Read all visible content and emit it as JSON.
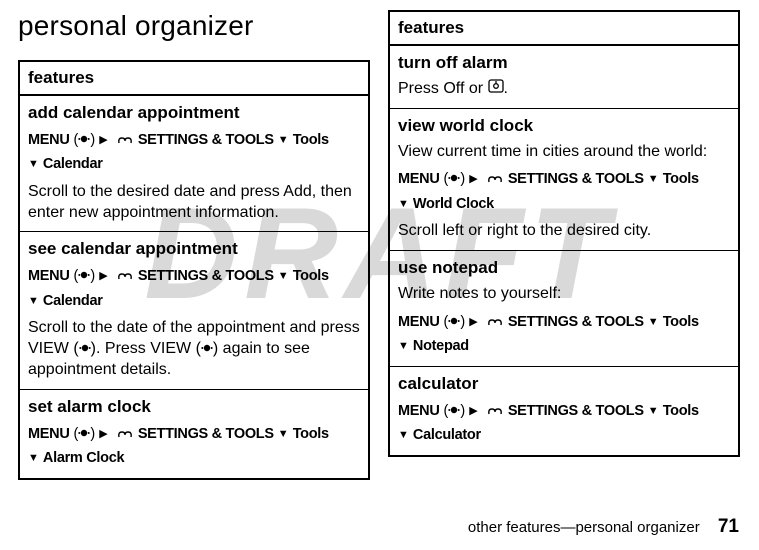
{
  "watermark": "DRAFT",
  "heading": "personal organizer",
  "col1": {
    "header": "features",
    "rows": [
      {
        "title": "add calendar appointment",
        "nav": {
          "menu": "MENU",
          "settings": "SETTINGS & TOOLS",
          "tools": "Tools",
          "sub": "Calendar"
        },
        "desc_pre": "Scroll to the desired date and press ",
        "desc_key": "Add",
        "desc_post": ", then enter new appointment information."
      },
      {
        "title": "see calendar appointment",
        "nav": {
          "menu": "MENU",
          "settings": "SETTINGS & TOOLS",
          "tools": "Tools",
          "sub": "Calendar"
        },
        "desc_pre": "Scroll to the date of the appointment and press ",
        "desc_key": "VIEW",
        "desc_mid": ". Press ",
        "desc_key2": "VIEW",
        "desc_post": " again to see appointment details."
      },
      {
        "title": "set alarm clock",
        "nav": {
          "menu": "MENU",
          "settings": "SETTINGS & TOOLS",
          "tools": "Tools",
          "sub": "Alarm Clock"
        }
      }
    ]
  },
  "col2": {
    "header": "features",
    "rows": [
      {
        "title": "turn off alarm",
        "alarm_pre": "Press ",
        "alarm_key": "Off",
        "alarm_mid": " or ",
        "alarm_post": "."
      },
      {
        "title": "view world clock",
        "intro": "View current time in cities around the world:",
        "nav": {
          "menu": "MENU",
          "settings": "SETTINGS & TOOLS",
          "tools": "Tools",
          "sub": "World Clock"
        },
        "desc": "Scroll left or right to the desired city."
      },
      {
        "title": "use notepad",
        "intro": "Write notes to yourself:",
        "nav": {
          "menu": "MENU",
          "settings": "SETTINGS & TOOLS",
          "tools": "Tools",
          "sub": "Notepad"
        }
      },
      {
        "title": "calculator",
        "nav": {
          "menu": "MENU",
          "settings": "SETTINGS & TOOLS",
          "tools": "Tools",
          "sub": "Calculator"
        }
      }
    ]
  },
  "footer": {
    "text": "other features—personal organizer",
    "page": "71"
  }
}
